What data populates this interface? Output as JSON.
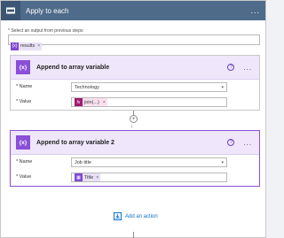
{
  "loop": {
    "title": "Apply to each",
    "more": "...",
    "select_label": "* Select an output from previous steps",
    "token": "results",
    "token_remove": "×"
  },
  "card1": {
    "title": "Append to array variable",
    "help": "?",
    "more": "...",
    "name_label": "* Name",
    "name_value": "Technology",
    "value_label": "* Value",
    "value_token": "join(...)",
    "value_remove": "×"
  },
  "connector": {
    "plus": "+",
    "arrow": "↓"
  },
  "card2": {
    "title": "Append to array variable 2",
    "help": "?",
    "more": "...",
    "name_label": "* Name",
    "name_value": "Job title",
    "value_label": "* Value",
    "value_token": "Title",
    "value_remove": "×"
  },
  "add_action": {
    "label": "Add an action"
  },
  "colors": {
    "loop_header": "#4e6b8a",
    "variable_accent": "#8a4fd8",
    "expression_accent": "#a0186e",
    "link": "#0b6fd0"
  }
}
